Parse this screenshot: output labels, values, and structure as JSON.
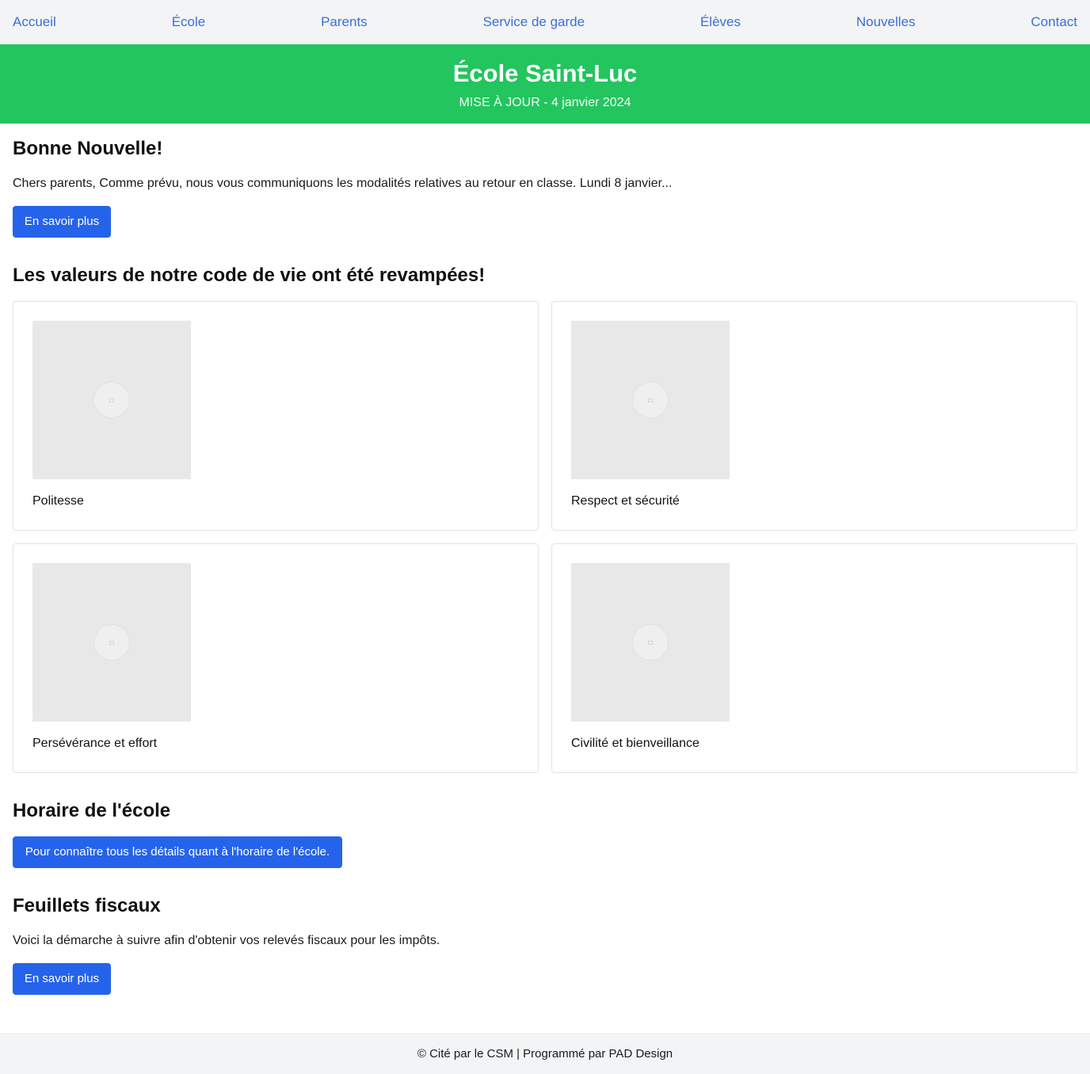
{
  "nav": {
    "items": [
      {
        "label": "Accueil"
      },
      {
        "label": "École"
      },
      {
        "label": "Parents"
      },
      {
        "label": "Service de garde"
      },
      {
        "label": "Élèves"
      },
      {
        "label": "Nouvelles"
      },
      {
        "label": "Contact"
      }
    ]
  },
  "hero": {
    "title": "École Saint-Luc",
    "subtitle": "MISE À JOUR - 4 janvier 2024"
  },
  "news": {
    "heading": "Bonne Nouvelle!",
    "text": "Chers parents, Comme prévu, nous vous communiquons les modalités relatives au retour en classe. Lundi 8 janvier...",
    "button": "En savoir plus"
  },
  "values": {
    "heading": "Les valeurs de notre code de vie ont été revampées!",
    "cards": [
      {
        "label": "Politesse",
        "icon": "image-placeholder-icon"
      },
      {
        "label": "Respect et sécurité",
        "icon": "image-placeholder-icon"
      },
      {
        "label": "Persévérance et effort",
        "icon": "image-placeholder-icon"
      },
      {
        "label": "Civilité et bienveillance",
        "icon": "image-placeholder-icon"
      }
    ]
  },
  "schedule": {
    "heading": "Horaire de l'école",
    "button": "Pour connaître tous les détails quant à l'horaire de l'école."
  },
  "tax": {
    "heading": "Feuillets fiscaux",
    "text": "Voici la démarche à suivre afin d'obtenir vos relevés fiscaux pour les impôts.",
    "button": "En savoir plus"
  },
  "footer": {
    "text": "© Cité par le CSM | Programmé par PAD Design"
  },
  "colors": {
    "nav_link": "#3b6fd4",
    "hero_bg": "#22c55e",
    "button_bg": "#2563eb",
    "nav_bg": "#f3f4f6"
  }
}
